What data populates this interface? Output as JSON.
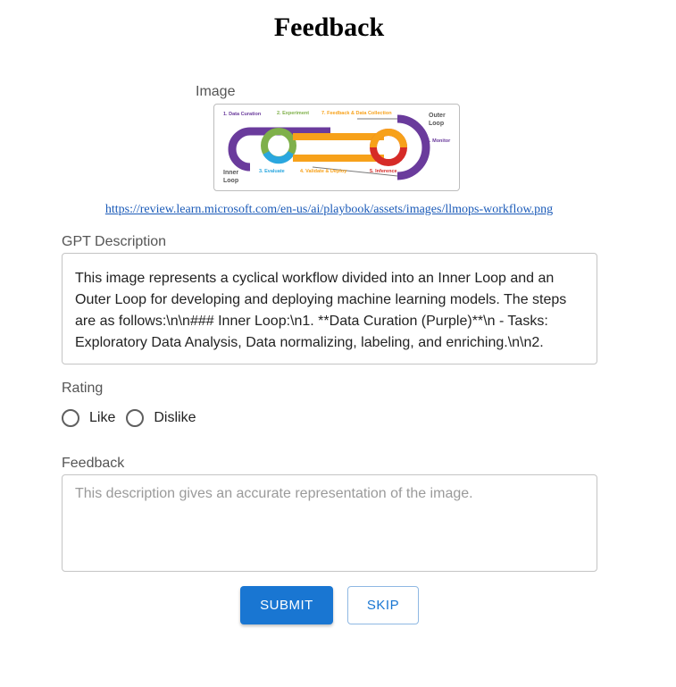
{
  "page": {
    "title": "Feedback"
  },
  "image_section": {
    "label": "Image",
    "link_text": "https://review.learn.microsoft.com/en-us/ai/playbook/assets/images/llmops-workflow.png",
    "diagram": {
      "steps": [
        "1. Data Curation",
        "2. Experiment",
        "3. Evaluate",
        "4. Validate & Deploy",
        "5. Inference",
        "6. Monitor",
        "7. Feedback & Data Collection"
      ],
      "loop_labels": [
        "Inner",
        "Loop",
        "Outer",
        "Loop"
      ],
      "colors": {
        "purple": "#6a3b9c",
        "green": "#7fb04a",
        "blue": "#2aa7df",
        "orange": "#f7a11a",
        "red": "#d62b27"
      }
    }
  },
  "gpt_description": {
    "label": "GPT Description",
    "text": "This image represents a cyclical workflow divided into an Inner Loop and an Outer Loop for developing and deploying machine learning models. The steps are as follows:\\n\\n### Inner Loop:\\n1. **Data Curation (Purple)**\\n   - Tasks: Exploratory Data Analysis, Data normalizing, labeling, and enriching.\\n\\n2."
  },
  "rating": {
    "label": "Rating",
    "options": [
      "Like",
      "Dislike"
    ]
  },
  "feedback": {
    "label": "Feedback",
    "placeholder": "This description gives an accurate representation of the image."
  },
  "actions": {
    "submit_label": "SUBMIT",
    "skip_label": "SKIP"
  },
  "colors": {
    "primary": "#1976d2",
    "link": "#1a5ab8"
  }
}
